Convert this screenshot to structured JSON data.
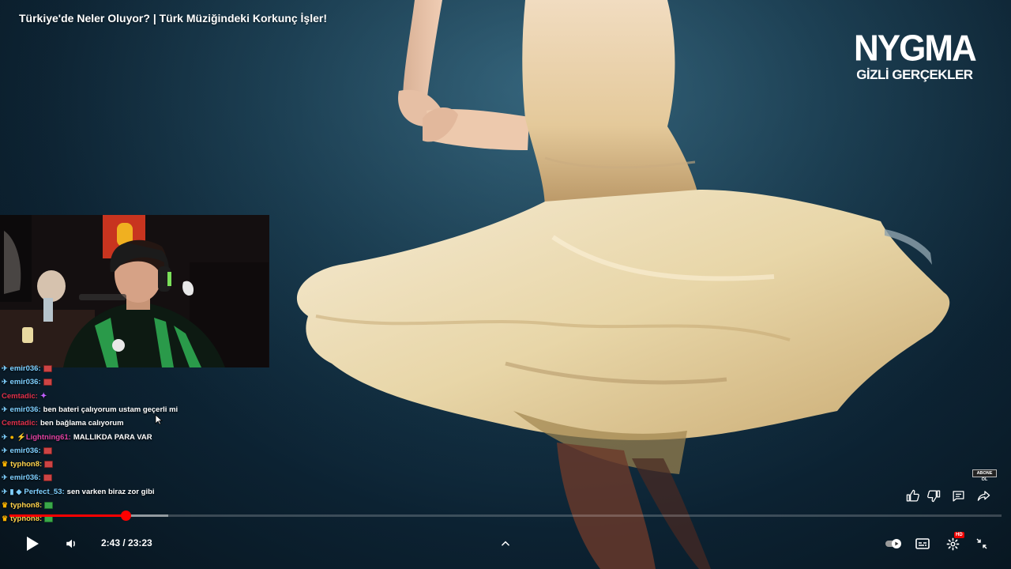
{
  "video": {
    "title": "Türkiye'de Neler Oluyor? | Türk Müziğindeki Korkunç İşler!",
    "brand_line1": "NYGMA",
    "brand_line2": "GİZLİ GERÇEKLER"
  },
  "subscribe_badge": "ABONE OL",
  "chat": [
    {
      "user": "emir036:",
      "message": "",
      "user_color": "#7fd0ff",
      "badges": [
        "✈"
      ],
      "emote": "red"
    },
    {
      "user": "emir036:",
      "message": "",
      "user_color": "#7fd0ff",
      "badges": [
        "✈"
      ],
      "emote": "red"
    },
    {
      "user": "Cemtadic:",
      "message": "",
      "user_color": "#e0304a",
      "badges": [],
      "emote": "purple"
    },
    {
      "user": "emir036:",
      "message": "ben bateri çalıyorum ustam geçerli mi",
      "user_color": "#7fd0ff",
      "badges": [
        "✈"
      ],
      "emote": ""
    },
    {
      "user": "Cemtadic:",
      "message": "ben bağlama calıyorum",
      "user_color": "#e0304a",
      "badges": [],
      "emote": ""
    },
    {
      "user": "⚡Lightning61:",
      "message": "MALLIKDA PARA VAR",
      "user_color": "#e040a0",
      "badges": [
        "✈",
        "●"
      ],
      "emote": ""
    },
    {
      "user": "emir036:",
      "message": "",
      "user_color": "#7fd0ff",
      "badges": [
        "✈"
      ],
      "emote": "red"
    },
    {
      "user": "typhon8:",
      "message": "",
      "user_color": "#ffd24a",
      "badges": [
        "♛"
      ],
      "emote": "red"
    },
    {
      "user": "emir036:",
      "message": "",
      "user_color": "#7fd0ff",
      "badges": [
        "✈"
      ],
      "emote": "red"
    },
    {
      "user": "Perfect_53:",
      "message": "sen varken biraz zor gibi",
      "user_color": "#7fd0ff",
      "badges": [
        "✈",
        "▮",
        "◆"
      ],
      "emote": ""
    },
    {
      "user": "typhon8:",
      "message": "",
      "user_color": "#ffd24a",
      "badges": [
        "♛"
      ],
      "emote": "green"
    },
    {
      "user": "typhon8:",
      "message": "",
      "user_color": "#ffd24a",
      "badges": [
        "♛"
      ],
      "emote": "green"
    }
  ],
  "player": {
    "current_time": "2:43",
    "duration": "23:23",
    "time_display": "2:43 / 23:23",
    "played_fraction": 0.117,
    "loaded_fraction": 0.16,
    "hd_label": "HD",
    "accent_color": "#ff0000"
  },
  "icons": {
    "play": "play-icon",
    "volume": "volume-icon",
    "expand": "chevron-up-icon",
    "autoplay": "autoplay-toggle-icon",
    "subtitles": "subtitles-icon",
    "settings": "gear-icon",
    "exit_fullscreen": "exit-fullscreen-icon",
    "like": "thumbs-up-icon",
    "dislike": "thumbs-down-icon",
    "comments": "comment-icon",
    "share": "share-icon"
  }
}
